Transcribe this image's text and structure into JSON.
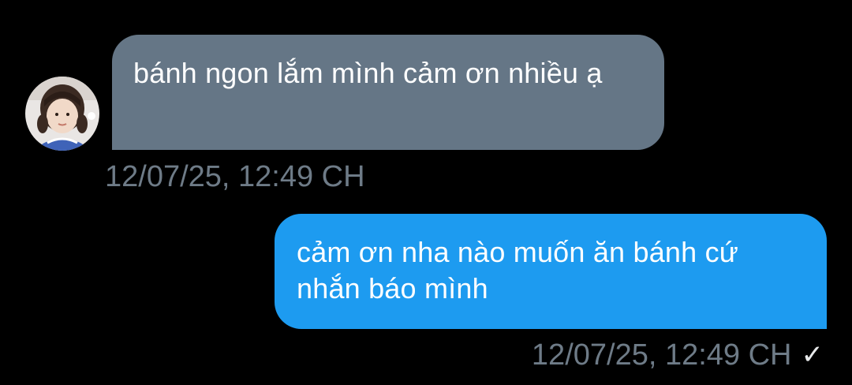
{
  "messages": [
    {
      "direction": "incoming",
      "text": "bánh ngon lắm mình cảm ơn nhiều ạ",
      "timestamp": "12/07/25, 12:49 CH",
      "avatar_icon": "user-avatar"
    },
    {
      "direction": "outgoing",
      "text": "cảm ơn nha nào muốn ăn bánh cứ nhắn báo mình",
      "timestamp": "12/07/25, 12:49 CH",
      "status_icon": "check-icon",
      "status_glyph": "✓"
    }
  ],
  "colors": {
    "background": "#000000",
    "incoming_bubble": "#657686",
    "outgoing_bubble": "#1d9bf0",
    "timestamp": "#6e7b87",
    "text": "#ffffff"
  }
}
